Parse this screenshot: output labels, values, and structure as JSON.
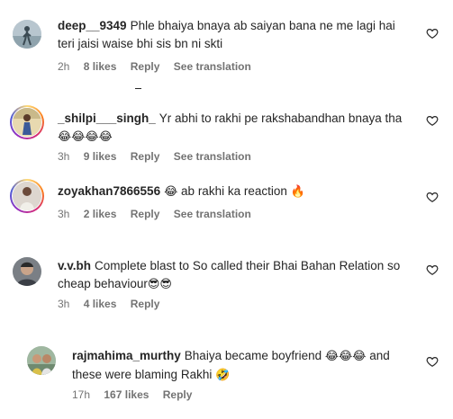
{
  "comments": [
    {
      "username": "deep__9349",
      "text": "Phle bhaiya bnaya ab saiyan bana ne me lagi hai teri jaisi waise bhi sis bn ni skti",
      "emojis": "",
      "time": "2h",
      "likes": "8 likes",
      "reply": "Reply",
      "translation": "See translation"
    },
    {
      "username": "_shilpi___singh_",
      "text": "Yr abhi to rakhi pe rakshabandhan bnaya tha",
      "emojis": "😂😂😂😂",
      "time": "3h",
      "likes": "9 likes",
      "reply": "Reply",
      "translation": "See translation"
    },
    {
      "username": "zoyakhan7866556",
      "text": "ab rakhi ka reaction",
      "emojis_prefix": "😂",
      "emojis_suffix": "🔥",
      "time": "3h",
      "likes": "2 likes",
      "reply": "Reply",
      "translation": "See translation"
    },
    {
      "username": "v.v.bh",
      "text": "Complete blast to So called their Bhai Bahan Relation so cheap behaviour",
      "emojis": "😎😎",
      "time": "3h",
      "likes": "4 likes",
      "reply": "Reply"
    },
    {
      "username": "rajmahima_murthy",
      "text_a": "Bhaiya became boyfriend",
      "emojis_a": "😂😂😂",
      "text_b": "and these were blaming Rakhi",
      "emojis_b": "🤣",
      "time": "17h",
      "likes": "167 likes",
      "reply": "Reply"
    }
  ],
  "icons": {
    "heart": "heart-outline-icon"
  },
  "colors": {
    "text": "#262626",
    "meta": "#737373",
    "story_ring": "#d62976"
  }
}
